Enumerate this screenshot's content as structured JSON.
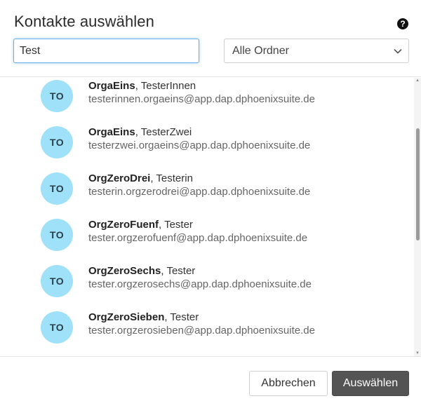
{
  "dialog": {
    "title": "Kontakte auswählen",
    "help_icon": "question-circle-icon"
  },
  "search": {
    "value": "Test"
  },
  "folder": {
    "selected": "Alle Ordner"
  },
  "contacts": [
    {
      "initials": "TO",
      "org": "OrgaEins",
      "name": ", TesterInnen",
      "email": "testerinnen.orgaeins@app.dap.dphoenixsuite.de"
    },
    {
      "initials": "TO",
      "org": "OrgaEins",
      "name": ", TesterZwei",
      "email": "testerzwei.orgaeins@app.dap.dphoenixsuite.de"
    },
    {
      "initials": "TO",
      "org": "OrgZeroDrei",
      "name": ", Testerin",
      "email": "testerin.orgzerodrei@app.dap.dphoenixsuite.de"
    },
    {
      "initials": "TO",
      "org": "OrgZeroFuenf",
      "name": ", Tester",
      "email": "tester.orgzerofuenf@app.dap.dphoenixsuite.de"
    },
    {
      "initials": "TO",
      "org": "OrgZeroSechs",
      "name": ", Tester",
      "email": "tester.orgzerosechs@app.dap.dphoenixsuite.de"
    },
    {
      "initials": "TO",
      "org": "OrgZeroSieben",
      "name": ", Tester",
      "email": "tester.orgzerosieben@app.dap.dphoenixsuite.de"
    }
  ],
  "footer": {
    "cancel_label": "Abbrechen",
    "select_label": "Auswählen"
  },
  "colors": {
    "avatar_bg": "#9ee1f8",
    "primary_button": "#545454",
    "input_focus": "#66afe9"
  }
}
